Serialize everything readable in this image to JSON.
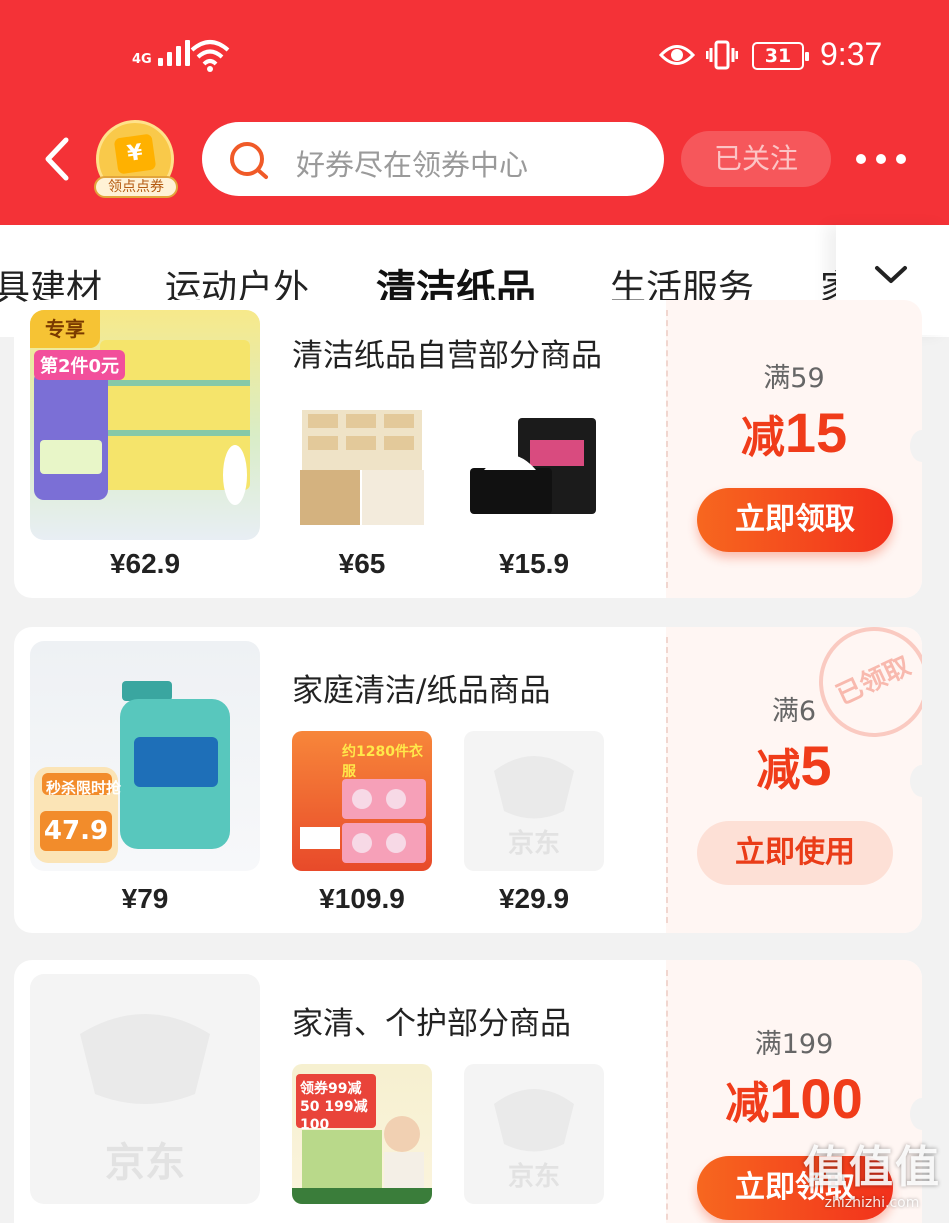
{
  "status_bar": {
    "network": "4G",
    "time": "9:37",
    "battery": "31"
  },
  "header": {
    "coupon_badge_label": "领点点券",
    "search_placeholder": "好券尽在领券中心",
    "follow_label": "已关注"
  },
  "categories": [
    {
      "label": "具建材"
    },
    {
      "label": "运动户外"
    },
    {
      "label": "清洁纸品",
      "active": true
    },
    {
      "label": "生活服务"
    },
    {
      "label": "家"
    }
  ],
  "coupons": [
    {
      "title": "清洁纸品自营部分商品",
      "main_price": "¥62.9",
      "main_tag": "专享",
      "main_tag2": "第2件0元",
      "items": [
        {
          "price": "¥65"
        },
        {
          "price": "¥15.9"
        }
      ],
      "condition": "满59",
      "amount_prefix": "减",
      "amount": "15",
      "button": "立即领取",
      "button_style": "primary"
    },
    {
      "title": "家庭清洁/纸品商品",
      "main_price": "¥79",
      "main_tag": "秒杀限时抢",
      "main_tag2": "47.9",
      "items": [
        {
          "price": "¥109.9",
          "tag": "约1280件衣服"
        },
        {
          "price": "¥29.9"
        }
      ],
      "condition": "满6",
      "amount_prefix": "减",
      "amount": "5",
      "button": "立即使用",
      "button_style": "secondary",
      "stamp": "已领取"
    },
    {
      "title": "家清、个护部分商品",
      "main_price": "",
      "items": [
        {
          "price": "",
          "tag": "领券99减50 199减100"
        },
        {
          "price": ""
        }
      ],
      "condition": "满199",
      "amount_prefix": "减",
      "amount": "100",
      "button": "立即领取",
      "button_style": "primary"
    }
  ],
  "placeholder_logo_text": "京东",
  "watermark": {
    "main": "值值值",
    "sub": "zhizhizhi.com"
  },
  "colors": {
    "header_red": "#f43237",
    "accent_orange": "#f05a28",
    "coupon_red": "#f03c1a"
  }
}
